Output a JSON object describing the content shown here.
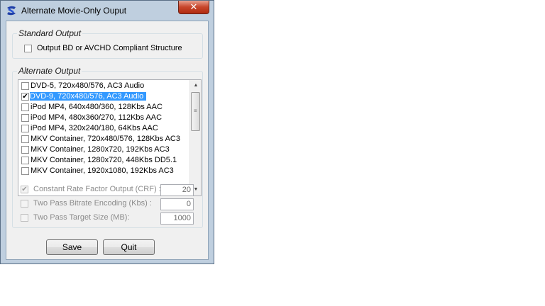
{
  "window": {
    "title": "Alternate Movie-Only Ouput",
    "close_glyph": "✕"
  },
  "standard_output": {
    "title": "Standard Output",
    "compliant_label": "Output BD or AVCHD Compliant Structure",
    "compliant_checked": false
  },
  "alternate_output": {
    "title": "Alternate Output",
    "items": [
      {
        "label": "DVD-5, 720x480/576, AC3 Audio",
        "checked": false,
        "selected": false
      },
      {
        "label": "DVD-9, 720x480/576, AC3 Audio",
        "checked": true,
        "selected": true
      },
      {
        "label": "iPod MP4, 640x480/360, 128Kbs AAC",
        "checked": false,
        "selected": false
      },
      {
        "label": "iPod MP4, 480x360/270, 112Kbs AAC",
        "checked": false,
        "selected": false
      },
      {
        "label": "iPod MP4, 320x240/180, 64Kbs AAC",
        "checked": false,
        "selected": false
      },
      {
        "label": "MKV Container, 720x480/576, 128Kbs AC3",
        "checked": false,
        "selected": false
      },
      {
        "label": "MKV Container, 1280x720, 192Kbs AC3",
        "checked": false,
        "selected": false
      },
      {
        "label": "MKV Container, 1280x720, 448Kbs DD5.1",
        "checked": false,
        "selected": false
      },
      {
        "label": "MKV Container, 1920x1080, 192Kbs AC3",
        "checked": false,
        "selected": false
      }
    ],
    "options": [
      {
        "label": "Constant Rate Factor Output (CRF) :",
        "checked": true,
        "value": "20"
      },
      {
        "label": "Two Pass Bitrate Encoding (Kbs) :",
        "checked": false,
        "value": "0"
      },
      {
        "label": "Two Pass Target Size (MB):",
        "checked": false,
        "value": "1000"
      }
    ]
  },
  "buttons": {
    "save": "Save",
    "quit": "Quit"
  },
  "icons": {
    "app": "app-icon",
    "close": "close-icon",
    "scroll_up": "chevron-up-icon",
    "scroll_down": "chevron-down-icon",
    "check": "checkmark-icon"
  }
}
